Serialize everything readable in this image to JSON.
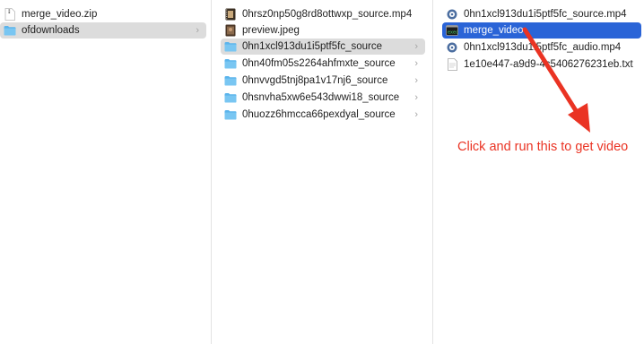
{
  "colors": {
    "accent_selected": "#2a64d7",
    "parent_selected": "#dcdcdc",
    "annotation": "#ea3323"
  },
  "columns": [
    {
      "items": [
        {
          "label": "merge_video.zip",
          "icon": "zip-file-icon",
          "chevron": ""
        },
        {
          "label": "ofdownloads",
          "icon": "folder-icon",
          "chevron": "›"
        }
      ]
    },
    {
      "items": [
        {
          "label": "0hrsz0np50g8rd8ottwxp_source.mp4",
          "icon": "video-file-icon",
          "chevron": ""
        },
        {
          "label": "preview.jpeg",
          "icon": "image-file-icon",
          "chevron": ""
        },
        {
          "label": "0hn1xcl913du1i5ptf5fc_source",
          "icon": "folder-icon",
          "chevron": "›"
        },
        {
          "label": "0hn40fm05s2264ahfmxte_source",
          "icon": "folder-icon",
          "chevron": "›"
        },
        {
          "label": "0hnvvgd5tnj8pa1v17nj6_source",
          "icon": "folder-icon",
          "chevron": "›"
        },
        {
          "label": "0hsnvha5xw6e543dwwi18_source",
          "icon": "folder-icon",
          "chevron": "›"
        },
        {
          "label": "0huozz6hmcca66pexdyal_source",
          "icon": "folder-icon",
          "chevron": "›"
        }
      ]
    },
    {
      "items": [
        {
          "label": "0hn1xcl913du1i5ptf5fc_source.mp4",
          "icon": "media-file-icon",
          "chevron": ""
        },
        {
          "label": "merge_video",
          "icon": "terminal-exec-icon",
          "chevron": ""
        },
        {
          "label": "0hn1xcl913du1i5ptf5fc_audio.mp4",
          "icon": "media-file-icon",
          "chevron": ""
        },
        {
          "label": "1e10e447-a9d9-4c5406276231eb.txt",
          "icon": "text-file-icon",
          "chevron": ""
        }
      ]
    }
  ],
  "annotation": {
    "text": "Click and run this to get video"
  }
}
